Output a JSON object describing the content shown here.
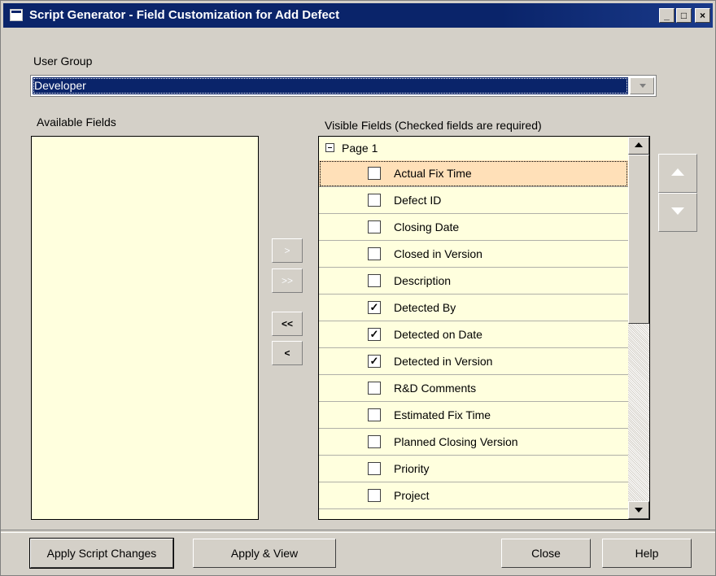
{
  "window": {
    "title": "Script Generator - Field Customization for Add Defect",
    "minimize": "_",
    "maximize": "□",
    "close": "×"
  },
  "user_group": {
    "label": "User Group",
    "value": "Developer"
  },
  "available": {
    "label": "Available Fields",
    "items": []
  },
  "visible": {
    "label": "Visible Fields (Checked fields are required)",
    "page": "Page 1",
    "fields": [
      {
        "label": "Actual Fix Time",
        "checked": false,
        "selected": true
      },
      {
        "label": "Defect ID",
        "checked": false
      },
      {
        "label": "Closing Date",
        "checked": false
      },
      {
        "label": "Closed in Version",
        "checked": false
      },
      {
        "label": "Description",
        "checked": false
      },
      {
        "label": "Detected By",
        "checked": true
      },
      {
        "label": "Detected on Date",
        "checked": true
      },
      {
        "label": "Detected in Version",
        "checked": true
      },
      {
        "label": "R&D Comments",
        "checked": false
      },
      {
        "label": "Estimated Fix Time",
        "checked": false
      },
      {
        "label": "Planned Closing Version",
        "checked": false
      },
      {
        "label": "Priority",
        "checked": false
      },
      {
        "label": "Project",
        "checked": false
      }
    ]
  },
  "transfer": {
    "add": ">",
    "add_all": ">>",
    "remove_all": "<<",
    "remove": "<"
  },
  "buttons": {
    "apply_script": "Apply Script Changes",
    "apply_view": "Apply & View",
    "close": "Close",
    "help": "Help"
  }
}
